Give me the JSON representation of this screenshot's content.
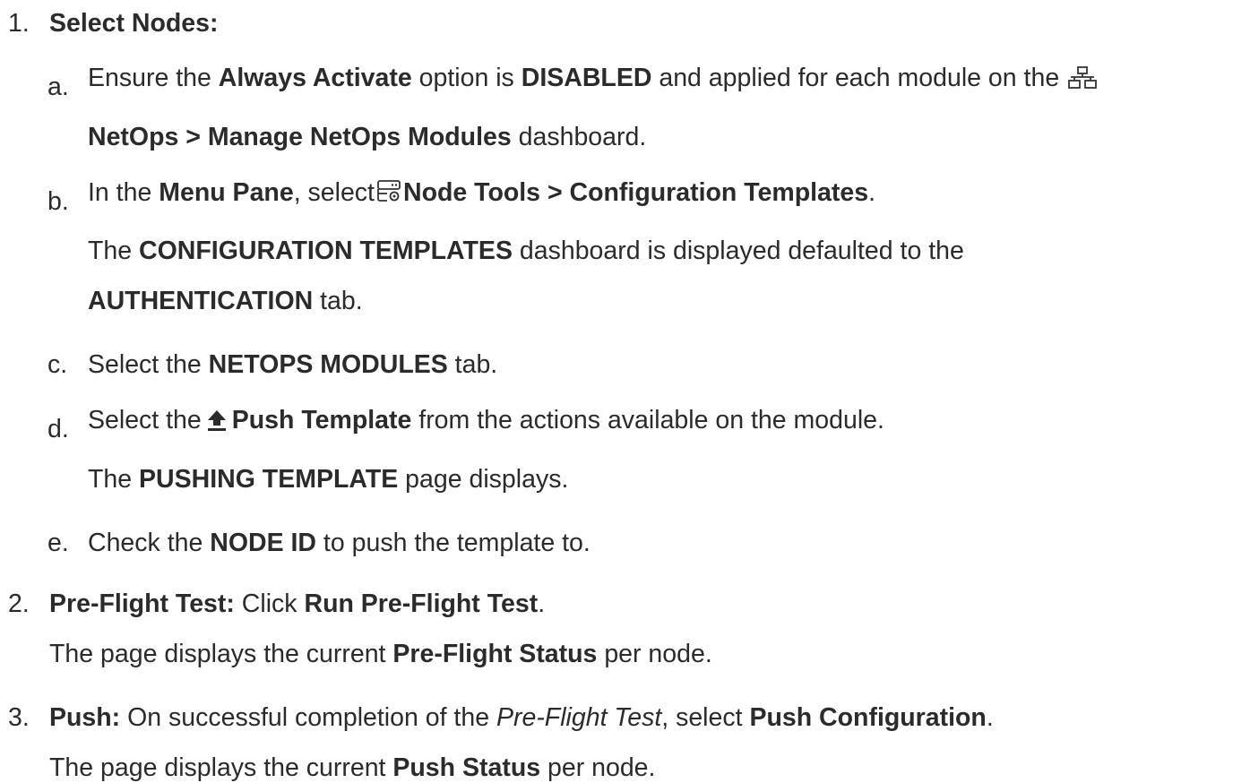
{
  "steps": [
    {
      "marker": "1.",
      "title": "Select Nodes:"
    },
    {
      "marker": "2.",
      "title": "Pre-Flight Test:",
      "text1": " Click ",
      "bold1": "Run Pre-Flight Test",
      "text2": ".",
      "note1": "The page displays the current ",
      "note_bold": "Pre-Flight Status",
      "note2": " per node."
    },
    {
      "marker": "3.",
      "title": "Push:",
      "text1": " On successful completion of the ",
      "italic": "Pre-Flight Test",
      "text2": ", select ",
      "bold1": "Push Configuration",
      "text3": ".",
      "note1": "The page displays the current ",
      "note_bold": "Push Status",
      "note2": " per node."
    }
  ],
  "substeps": {
    "a": {
      "marker": "a.",
      "t1": "Ensure the ",
      "b1": "Always Activate",
      "t2": " option is ",
      "b2": "DISABLED",
      "t3": " and applied for each module on the ",
      "b3": "NetOps > Manage NetOps Modules",
      "t4": " dashboard.",
      "icon": "network-icon"
    },
    "b": {
      "marker": "b.",
      "t1": "In the ",
      "b1": "Menu Pane",
      "t2": ", select",
      "b2": "Node Tools > Configuration Templates",
      "t3": ".",
      "n1": "The ",
      "nb1": "CONFIGURATION TEMPLATES",
      "n2": " dashboard is displayed defaulted to the",
      "nb2": "AUTHENTICATION",
      "n3": " tab.",
      "icon": "node-tools-icon"
    },
    "c": {
      "marker": "c.",
      "t1": "Select the ",
      "b1": "NETOPS MODULES",
      "t2": " tab."
    },
    "d": {
      "marker": "d.",
      "t1": "Select the",
      "b1": "Push Template",
      "t2": " from the actions available on the module.",
      "n1": "The ",
      "nb1": "PUSHING TEMPLATE",
      "n2": " page displays.",
      "icon": "upload-icon"
    },
    "e": {
      "marker": "e.",
      "t1": "Check the ",
      "b1": "NODE ID",
      "t2": " to push the template to."
    }
  }
}
